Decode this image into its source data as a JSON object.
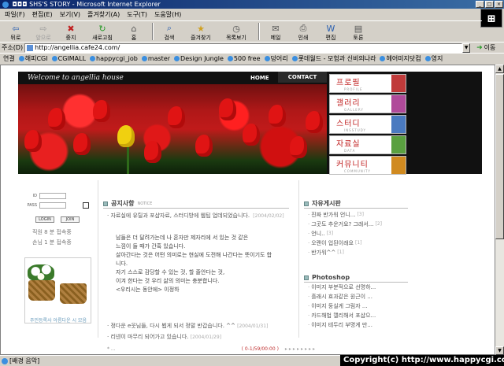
{
  "window": {
    "title": "SHS'S STORY - Microsoft Internet Explorer",
    "title_prefix": "◘◘◘"
  },
  "menu": [
    "파일(F)",
    "편집(E)",
    "보기(V)",
    "즐겨찾기(A)",
    "도구(T)",
    "도움말(H)"
  ],
  "toolbar": {
    "back": "뒤로",
    "forward": "앞으로",
    "stop": "중지",
    "refresh": "새로고침",
    "home": "홈",
    "search": "검색",
    "favorites": "즐겨찾기",
    "history": "목록보기",
    "mail": "메일",
    "print": "인쇄",
    "edit": "편집",
    "discuss": "토론"
  },
  "address": {
    "label": "주소(D)",
    "url": "http://angellia.cafe24.com/",
    "go_label": "이동"
  },
  "links": {
    "label": "연결",
    "items": [
      "해피CGI",
      "CGIMALL",
      "happycgi_job",
      "master",
      "Design Jungle",
      "500 free",
      "덩어리",
      "롯데월드 - 모험과 신비의나라",
      "헤어미지닷컴",
      "영지"
    ]
  },
  "page": {
    "welcome": "Welcome to angellia house",
    "nav_home": "HOME",
    "nav_contact": "CONTACT",
    "menu_buttons": [
      {
        "kr": "프로필",
        "en": "PROFILE",
        "color": "#c03a3a"
      },
      {
        "kr": "갤러리",
        "en": "GALLERY",
        "color": "#b04a9a"
      },
      {
        "kr": "스터디",
        "en": "INSSTUDY",
        "color": "#4a7ac0"
      },
      {
        "kr": "자료실",
        "en": "DATA",
        "color": "#5aa040"
      },
      {
        "kr": "커뮤니티",
        "en": "COMMUNITY",
        "color": "#d08a20"
      }
    ],
    "login": {
      "id_label": "ID",
      "pass_label": "PASS",
      "login_btn": "LOGIN",
      "join_btn": "JOIN"
    },
    "stats": {
      "line1": "직원    8 분 접속중",
      "line2": "손님    1 분 접속중"
    },
    "flower_caption": "주민등록사 아름다운 시 모음",
    "notice": {
      "title": "공지사항",
      "subtitle": "NOTICE",
      "first_item": "자료실에 유틸과 포샵자료, 스터디방에 웹팁 업데되었습니다.",
      "first_date": "[2004/02/02]",
      "poem": [
        "남들은 더 달려가는데 나 혼자만 제자리에 서 있는 것 같은",
        "느낌이 들 때가 간혹 있습니다.",
        "살아간다는 것은 어떤 의미로는 현실에 도전해 나간다는 뜻이기도 합",
        "니다.",
        "자기 스스로 감당할 수 있는 것, 할 줄안다는 것,",
        "이겨 한다는 것 우리 삶의 의미는 충분합니다.",
        "<우리시는 동안에> 이정하"
      ],
      "item2": "정다운 e웃님들, 다시 뵙게 되서 정말 반갑습니다. ^^",
      "item2_date": "[2004/01/31]",
      "item3": "리넨이 마무리 되어가고 있습니다.",
      "item3_date": "[2004/01/29]"
    },
    "board": {
      "title": "자유게시판",
      "items": [
        {
          "text": "진짜 반가워 언니...",
          "count": "[3]"
        },
        {
          "text": "그곳도 추운거요? 그래서...",
          "count": "[2]"
        },
        {
          "text": "언니..",
          "count": "[3]"
        },
        {
          "text": "오랜이 업된이래요",
          "count": "[1]"
        },
        {
          "text": "반가워^^",
          "count": "[1]"
        }
      ]
    },
    "photoshop": {
      "title": "Photoshop",
      "items": [
        "이미지 부분적으로 선명하...",
        "흘래시 효과같은 원근이 ...",
        "이미지 둥실게 그림자 ...",
        "카드해법 캘리해서 포샵으...",
        "이미지 테두리 부명게 만..."
      ]
    },
    "bottom_left": "* ...",
    "bottom_counter": "( 0-1/59/00:00 )"
  },
  "status": {
    "text": "[배경 음악]",
    "copyright": "Copyright(c) http://www.happycgi.com"
  }
}
